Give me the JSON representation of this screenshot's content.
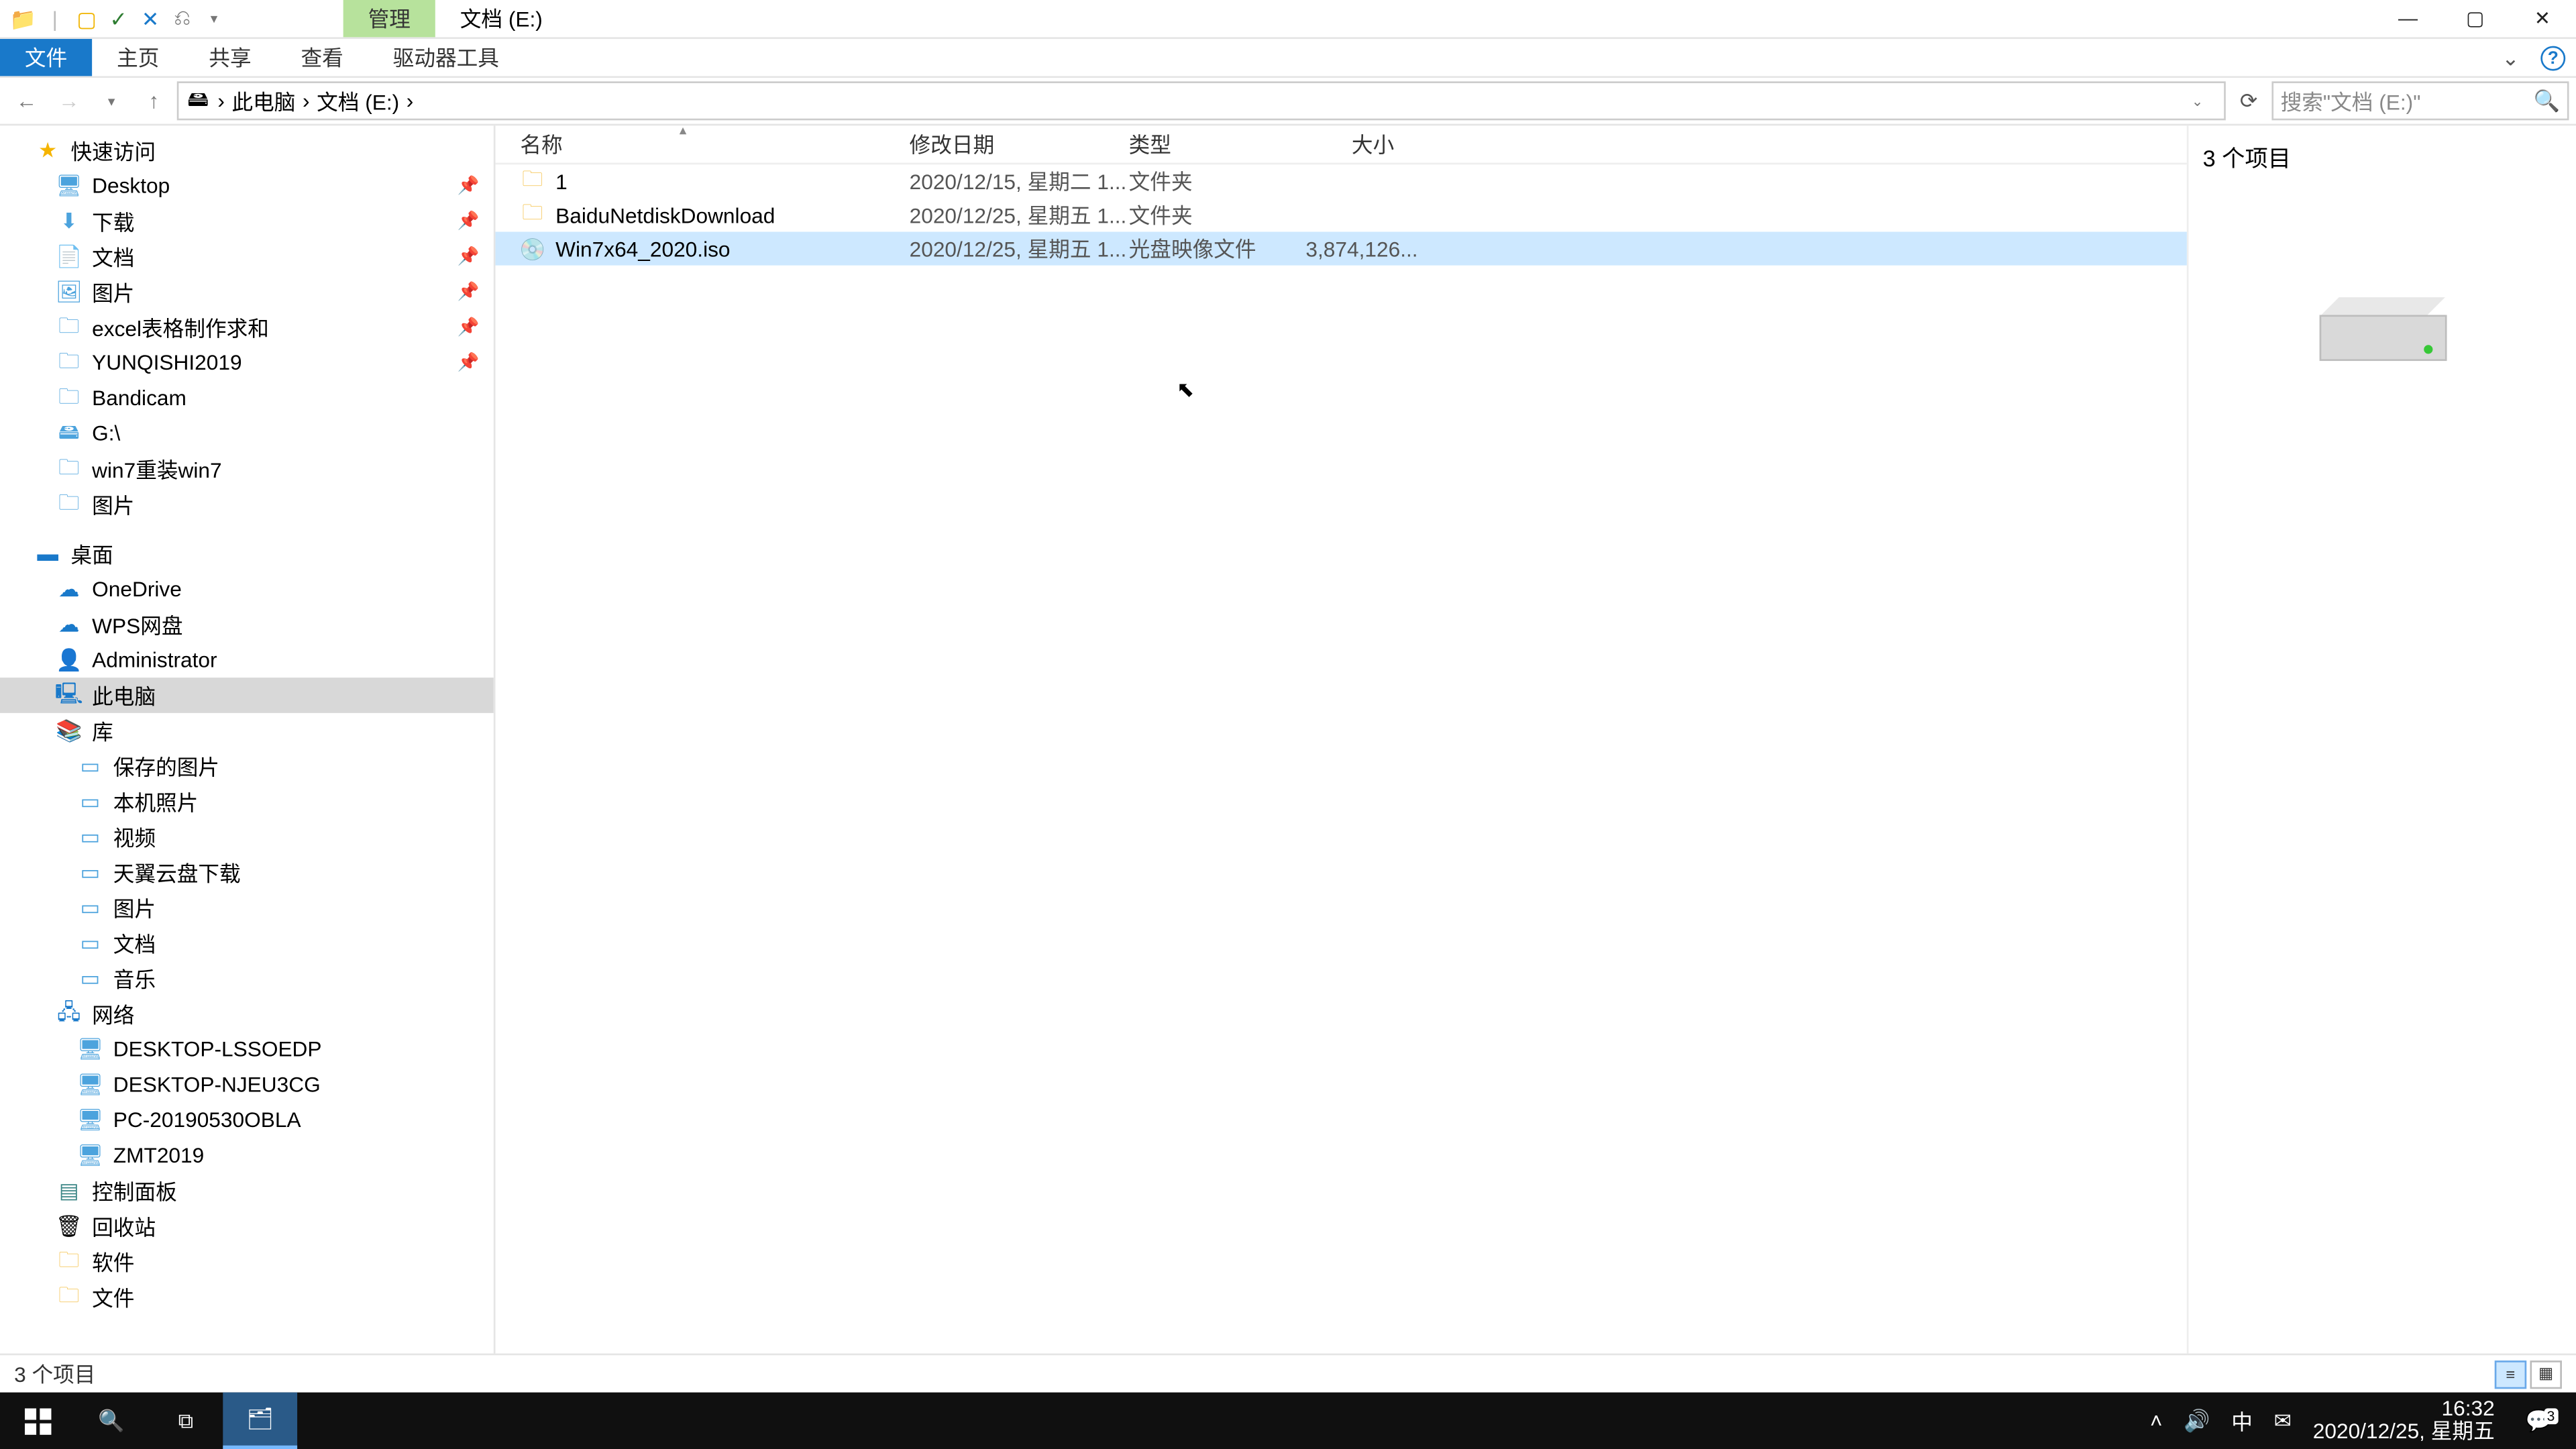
{
  "title": {
    "tool_tab": "管理",
    "window": "文档 (E:)"
  },
  "ribbon": {
    "file": "文件",
    "home": "主页",
    "share": "共享",
    "view": "查看",
    "drive": "驱动器工具"
  },
  "breadcrumb": {
    "a": "此电脑",
    "b": "文档 (E:)"
  },
  "search": {
    "placeholder": "搜索\"文档 (E:)\""
  },
  "nav": {
    "quick": "快速访问",
    "q_items": [
      {
        "label": "Desktop",
        "icon": "desktop"
      },
      {
        "label": "下载",
        "icon": "download"
      },
      {
        "label": "文档",
        "icon": "doc"
      },
      {
        "label": "图片",
        "icon": "pic"
      },
      {
        "label": "excel表格制作求和",
        "icon": "folder"
      },
      {
        "label": "YUNQISHI2019",
        "icon": "folder"
      },
      {
        "label": "Bandicam",
        "icon": "folder"
      },
      {
        "label": "G:\\",
        "icon": "drive"
      },
      {
        "label": "win7重装win7",
        "icon": "folder"
      },
      {
        "label": "图片",
        "icon": "folder"
      }
    ],
    "desktop": "桌面",
    "d_items": [
      {
        "label": "OneDrive",
        "icon": "cloud"
      },
      {
        "label": "WPS网盘",
        "icon": "cloud2"
      },
      {
        "label": "Administrator",
        "icon": "user"
      },
      {
        "label": "此电脑",
        "icon": "pc",
        "sel": true
      },
      {
        "label": "库",
        "icon": "lib"
      }
    ],
    "lib_items": [
      {
        "label": "保存的图片"
      },
      {
        "label": "本机照片"
      },
      {
        "label": "视频"
      },
      {
        "label": "天翼云盘下载"
      },
      {
        "label": "图片"
      },
      {
        "label": "文档"
      },
      {
        "label": "音乐"
      }
    ],
    "network": "网络",
    "n_items": [
      {
        "label": "DESKTOP-LSSOEDP"
      },
      {
        "label": "DESKTOP-NJEU3CG"
      },
      {
        "label": "PC-20190530OBLA"
      },
      {
        "label": "ZMT2019"
      }
    ],
    "cp": "控制面板",
    "rb": "回收站",
    "soft": "软件",
    "docs": "文件"
  },
  "columns": {
    "name": "名称",
    "date": "修改日期",
    "type": "类型",
    "size": "大小"
  },
  "files": [
    {
      "name": "1",
      "date": "2020/12/15, 星期二 1...",
      "type": "文件夹",
      "size": "",
      "kind": "folder"
    },
    {
      "name": "BaiduNetdiskDownload",
      "date": "2020/12/25, 星期五 1...",
      "type": "文件夹",
      "size": "",
      "kind": "folder"
    },
    {
      "name": "Win7x64_2020.iso",
      "date": "2020/12/25, 星期五 1...",
      "type": "光盘映像文件",
      "size": "3,874,126...",
      "kind": "iso",
      "sel": true
    }
  ],
  "preview": {
    "count": "3 个项目"
  },
  "status": {
    "text": "3 个项目"
  },
  "tray": {
    "ime": "中",
    "time": "16:32",
    "date": "2020/12/25, 星期五",
    "notif": "3"
  }
}
